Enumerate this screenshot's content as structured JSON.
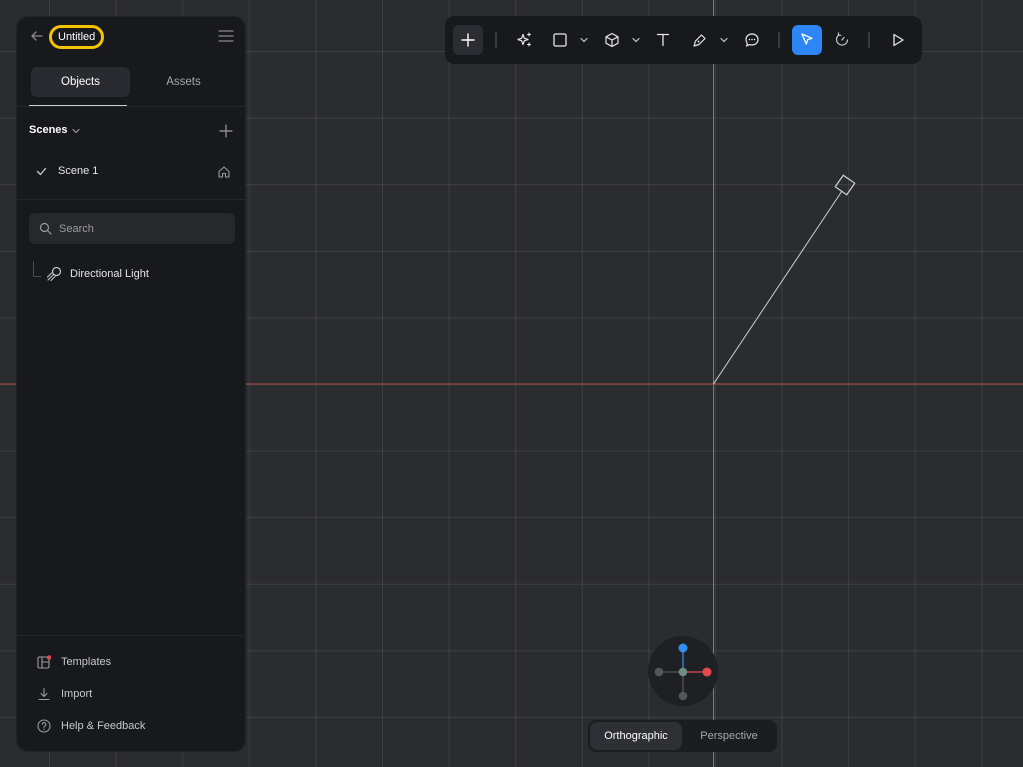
{
  "header": {
    "title": "Untitled"
  },
  "tabs": [
    {
      "label": "Objects",
      "active": true
    },
    {
      "label": "Assets",
      "active": false
    }
  ],
  "scenes": {
    "label": "Scenes",
    "items": [
      {
        "name": "Scene 1",
        "selected": true
      }
    ]
  },
  "search": {
    "placeholder": "Search",
    "value": ""
  },
  "tree": {
    "items": [
      {
        "label": "Directional Light",
        "icon": "directional-light-icon"
      }
    ]
  },
  "footer": {
    "templates": "Templates",
    "import": "Import",
    "help": "Help & Feedback"
  },
  "toolbar": {
    "tools": [
      "add",
      "ai-sparkles",
      "rectangle",
      "cube",
      "text",
      "pen",
      "comment",
      "select",
      "orbit",
      "play"
    ],
    "active_tool": "select"
  },
  "camera": {
    "options": [
      "Orthographic",
      "Perspective"
    ],
    "active": "Orthographic"
  },
  "colors": {
    "accent": "#2e86f5",
    "title_highlight": "#f5c400",
    "axis_x": "#c85050",
    "axis_y": "#2f8ef0",
    "notification_dot": "#e5484d"
  }
}
